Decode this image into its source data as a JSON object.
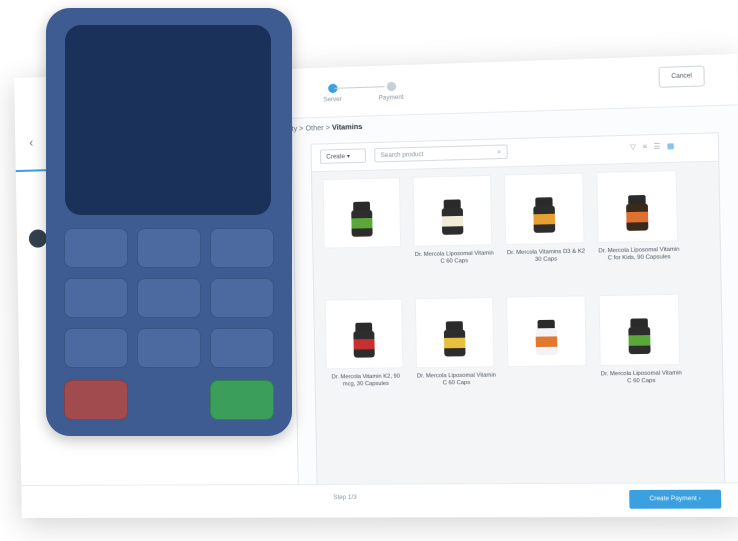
{
  "app": {
    "stepper": {
      "steps": [
        {
          "label": "Server"
        },
        {
          "label": "Payment"
        }
      ]
    },
    "cancel_label": "Cancel",
    "breadcrumb": {
      "prefix": "ty",
      "sep": ">",
      "middle": "Other",
      "current": "Vitamins"
    },
    "toolbar": {
      "dropdown_label": "Create",
      "search_placeholder": "Search product"
    },
    "products": [
      {
        "name": "",
        "body": "#2d2d2d",
        "label": "#5aa83a"
      },
      {
        "name": "Dr. Mercola Liposomal Vitamin C 60 Caps",
        "body": "#2d2d2d",
        "label": "#f0ecd8"
      },
      {
        "name": "Dr. Mercola Vitamins D3 & K2 30 Caps",
        "body": "#2d2d2d",
        "label": "#e8a030"
      },
      {
        "name": "Dr. Mercola Liposomal Vitamin C for Kids, 90 Capsules",
        "body": "#3a2a1a",
        "label": "#e07030"
      },
      {
        "name": "Dr. Mercola Vitamin K2, 90 mcg, 30 Capsules",
        "body": "#2d2d2d",
        "label": "#c83030"
      },
      {
        "name": "Dr. Mercola Liposomal Vitamin C 60 Caps",
        "body": "#2d2d2d",
        "label": "#e8c040"
      },
      {
        "name": "",
        "body": "#f4f4f8",
        "label": "#e07830"
      },
      {
        "name": "Dr. Mercola Liposomal Vitamin C 60 Caps",
        "body": "#2d2d2d",
        "label": "#5aa83a"
      }
    ],
    "footer": {
      "step_text": "Step 1/3",
      "create_label": "Create Payment"
    }
  }
}
